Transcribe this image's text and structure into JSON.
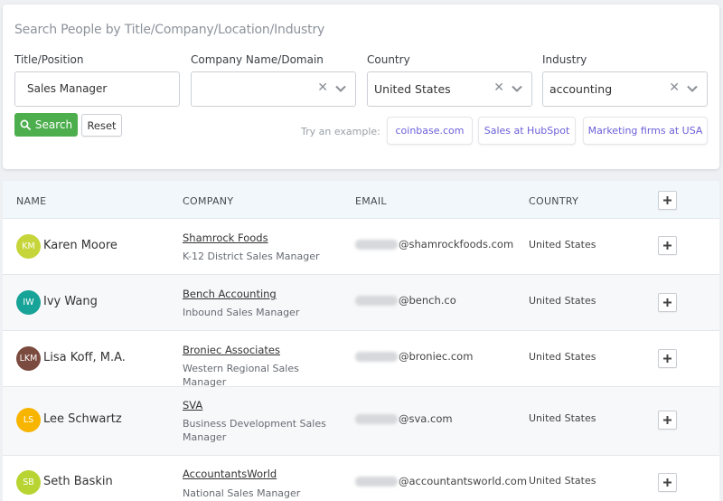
{
  "search": {
    "heading": "Search People by Title/Company/Location/Industry",
    "fields": {
      "title": {
        "label": "Title/Position",
        "value": "Sales Manager"
      },
      "company": {
        "label": "Company Name/Domain",
        "value": ""
      },
      "country": {
        "label": "Country",
        "value": "United States"
      },
      "industry": {
        "label": "Industry",
        "value": "accounting"
      }
    },
    "search_button": "Search",
    "reset_button": "Reset",
    "try_label": "Try an example:",
    "examples": [
      "coinbase.com",
      "Sales at HubSpot",
      "Marketing firms at USA"
    ]
  },
  "table": {
    "headers": {
      "name": "NAME",
      "company": "COMPANY",
      "email": "EMAIL",
      "country": "COUNTRY"
    },
    "rows": [
      {
        "initials": "KM",
        "avatar_color": "#c6d53a",
        "name": "Karen Moore",
        "company": "Shamrock Foods",
        "title": "K-12 District Sales Manager",
        "email_domain": "@shamrockfoods.com",
        "country": "United States"
      },
      {
        "initials": "IW",
        "avatar_color": "#17a398",
        "name": "Ivy Wang",
        "company": "Bench Accounting",
        "title": "Inbound Sales Manager",
        "email_domain": "@bench.co",
        "country": "United States"
      },
      {
        "initials": "LKM",
        "avatar_color": "#7b4b3f",
        "name": "Lisa Koff, M.A.",
        "company": "Broniec Associates",
        "title": "Western Regional Sales Manager",
        "email_domain": "@broniec.com",
        "country": "United States"
      },
      {
        "initials": "LS",
        "avatar_color": "#f7b500",
        "name": "Lee Schwartz",
        "company": "SVA",
        "title": "Business Development Sales Manager",
        "email_domain": "@sva.com",
        "country": "United States"
      },
      {
        "initials": "SB",
        "avatar_color": "#b8d432",
        "name": "Seth Baskin",
        "company": "AccountantsWorld",
        "title": "National Sales Manager",
        "email_domain": "@accountantsworld.com",
        "country": "United States"
      }
    ]
  },
  "colors": {
    "accent_green": "#4cae4c",
    "link_purple": "#6b5fd8",
    "header_bg": "#f2f7fb"
  },
  "icons": {
    "search": "search-icon",
    "clear": "clear-icon",
    "dropdown": "chevron-down-icon",
    "add": "plus-icon"
  }
}
